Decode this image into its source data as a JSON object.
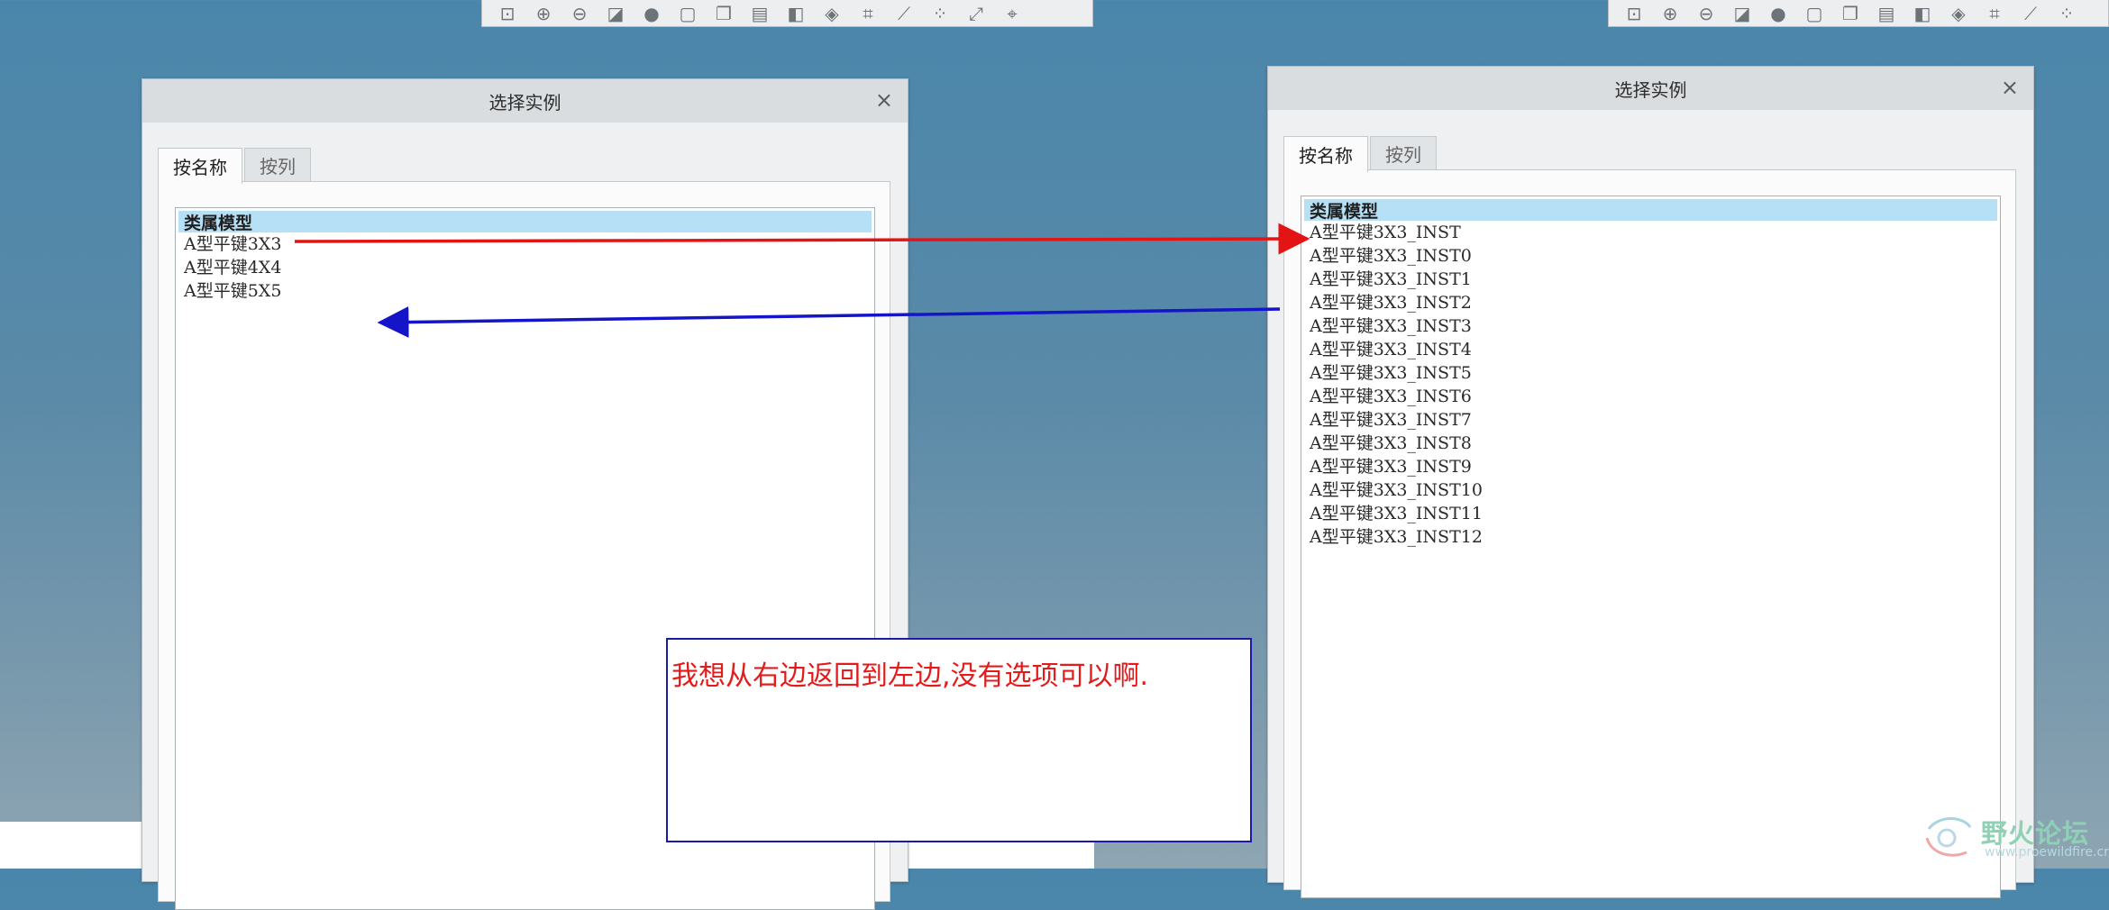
{
  "toolbar_icons": [
    "zoom-to-fit-icon",
    "zoom-in-icon",
    "zoom-out-icon",
    "repaint-icon",
    "shading-icon",
    "view-box-icon",
    "saved-views-icon",
    "layers-icon",
    "orient-icon",
    "appearance-icon",
    "datum-planes-icon",
    "datum-axes-icon",
    "datum-points-icon",
    "coordinate-system-icon",
    "annotation-icon"
  ],
  "left_dialog": {
    "title": "选择实例",
    "close_symbol": "×",
    "tabs": [
      {
        "label": "按名称"
      },
      {
        "label": "按列"
      }
    ],
    "list_header": "类属模型",
    "items": [
      "A型平键3X3",
      "A型平键4X4",
      "A型平键5X5"
    ]
  },
  "right_dialog": {
    "title": "选择实例",
    "close_symbol": "×",
    "tabs": [
      {
        "label": "按名称"
      },
      {
        "label": "按列"
      }
    ],
    "list_header": "类属模型",
    "items": [
      "A型平键3X3_INST",
      "A型平键3X3_INST0",
      "A型平键3X3_INST1",
      "A型平键3X3_INST2",
      "A型平键3X3_INST3",
      "A型平键3X3_INST4",
      "A型平键3X3_INST5",
      "A型平键3X3_INST6",
      "A型平键3X3_INST7",
      "A型平键3X3_INST8",
      "A型平键3X3_INST9",
      "A型平键3X3_INST10",
      "A型平键3X3_INST11",
      "A型平键3X3_INST12"
    ]
  },
  "annotation": {
    "text": "我想从右边返回到左边,没有选项可以啊."
  },
  "watermark": {
    "title": "野火论坛",
    "url": "www.proewildfire.cn"
  },
  "colors": {
    "selection_highlight": "#b6e0f6",
    "forward_arrow": "#e41414",
    "back_arrow": "#1414c8",
    "annotation_text": "#e31b1b",
    "annotation_border": "#1a1aa8"
  }
}
